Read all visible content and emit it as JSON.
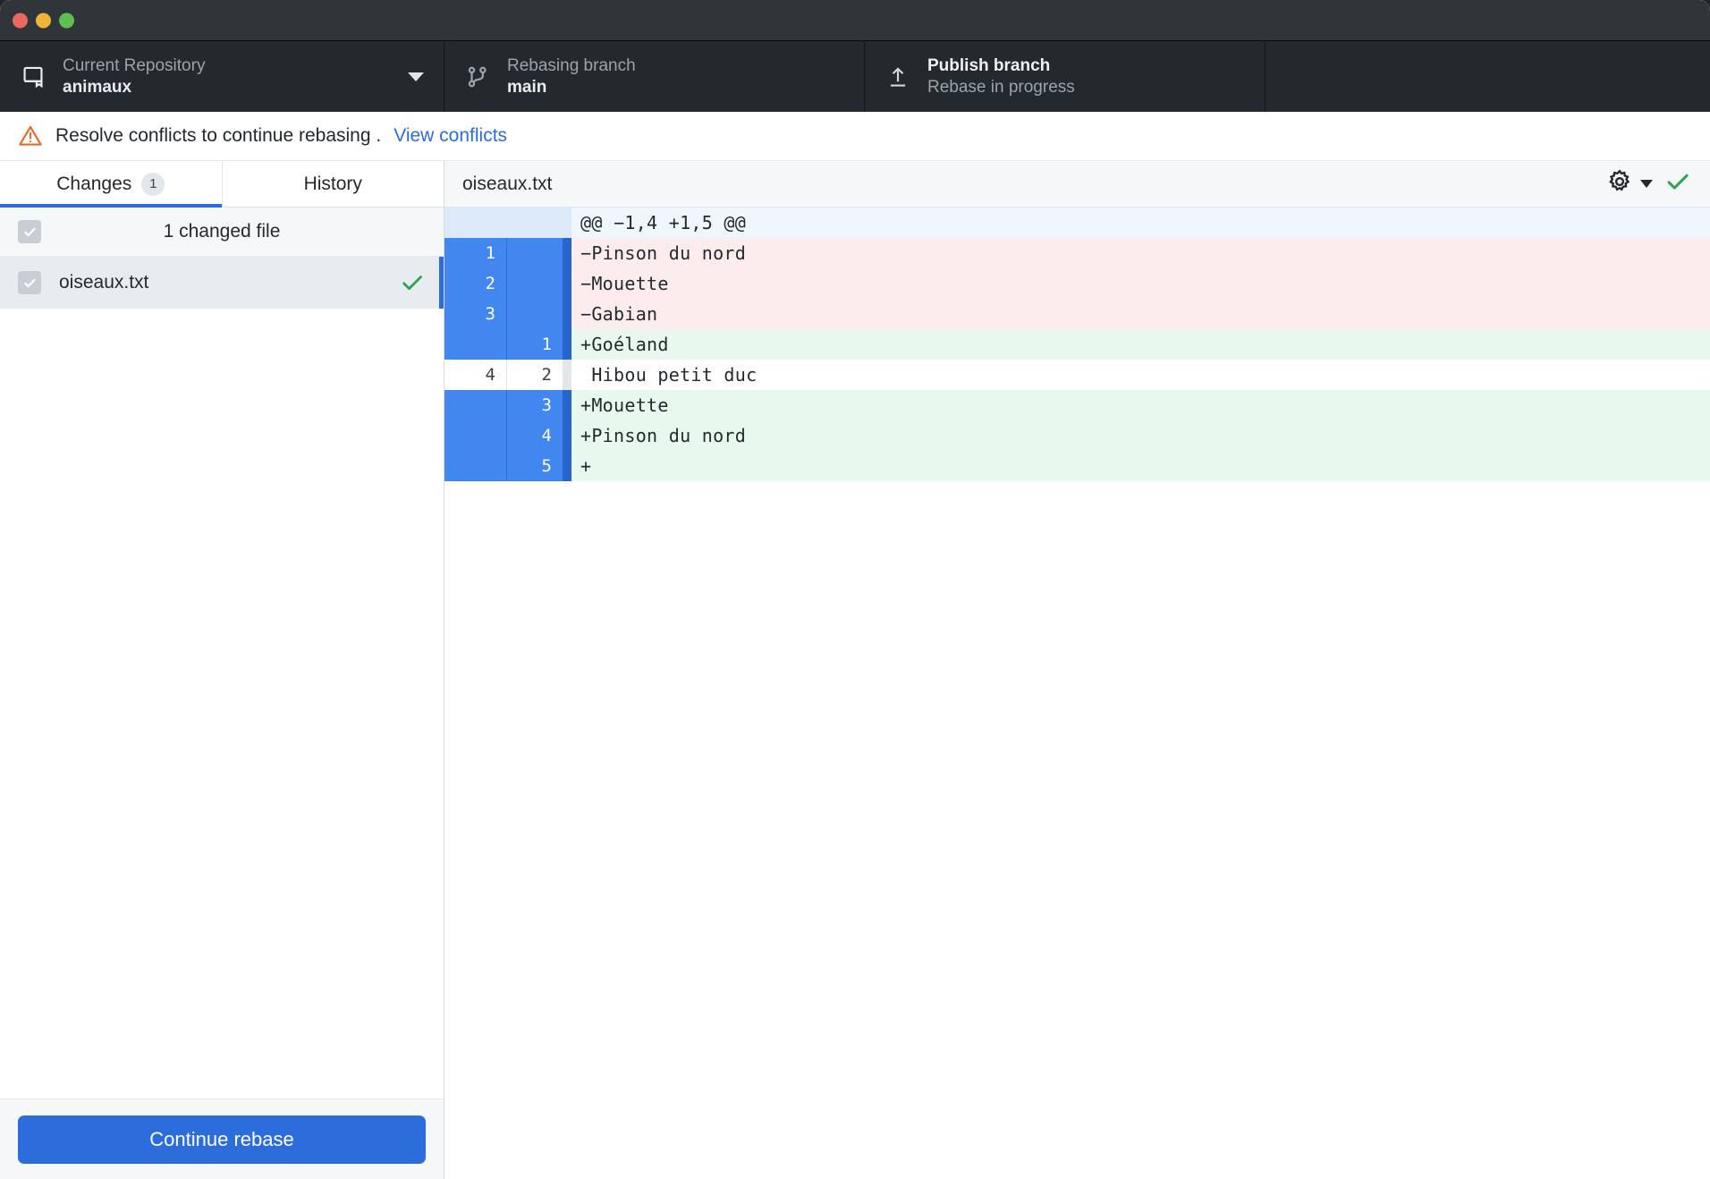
{
  "window": {
    "traffic_lights": [
      "close",
      "minimize",
      "zoom"
    ],
    "colors": {
      "close": "#e8695f",
      "minimize": "#f0b537",
      "zoom": "#5fc04f",
      "accent": "#2c6ddb",
      "toolbar_bg": "#24292e",
      "titlebar_bg": "#30353a"
    }
  },
  "toolbar": {
    "repository": {
      "icon": "repo-icon",
      "label": "Current Repository",
      "value": "animaux"
    },
    "branch": {
      "icon": "branch-icon",
      "label": "Rebasing branch",
      "value": "main"
    },
    "publish": {
      "icon": "upload-icon",
      "title": "Publish branch",
      "subtitle": "Rebase in progress"
    }
  },
  "banner": {
    "icon": "warning-icon",
    "message": "Resolve conflicts to continue rebasing .",
    "link": "View conflicts"
  },
  "sidebar": {
    "tabs": [
      {
        "label": "Changes",
        "badge": "1",
        "active": true
      },
      {
        "label": "History",
        "badge": "",
        "active": false
      }
    ],
    "list_header": {
      "label": "1 changed file",
      "checked": true
    },
    "files": [
      {
        "name": "oiseaux.txt",
        "checked": true,
        "status": "resolved",
        "selected": true
      }
    ],
    "footer": {
      "continue_button": "Continue rebase"
    }
  },
  "diff": {
    "header": {
      "filename": "oiseaux.txt",
      "gear_icon": "gear-icon",
      "caret_icon": "chevron-down-icon",
      "check_icon": "check-icon"
    },
    "rows": [
      {
        "type": "hunk",
        "old": "",
        "new": "",
        "text": "@@ −1,4 +1,5 @@",
        "selected": false
      },
      {
        "type": "del",
        "old": "1",
        "new": "",
        "text": "−Pinson du nord",
        "selected": true
      },
      {
        "type": "del",
        "old": "2",
        "new": "",
        "text": "−Mouette",
        "selected": true
      },
      {
        "type": "del",
        "old": "3",
        "new": "",
        "text": "−Gabian",
        "selected": true
      },
      {
        "type": "add",
        "old": "",
        "new": "1",
        "text": "+Goéland",
        "selected": true
      },
      {
        "type": "ctx",
        "old": "4",
        "new": "2",
        "text": " Hibou petit duc",
        "selected": false
      },
      {
        "type": "add",
        "old": "",
        "new": "3",
        "text": "+Mouette",
        "selected": true
      },
      {
        "type": "add",
        "old": "",
        "new": "4",
        "text": "+Pinson du nord",
        "selected": true
      },
      {
        "type": "add",
        "old": "",
        "new": "5",
        "text": "+",
        "selected": true
      }
    ]
  }
}
